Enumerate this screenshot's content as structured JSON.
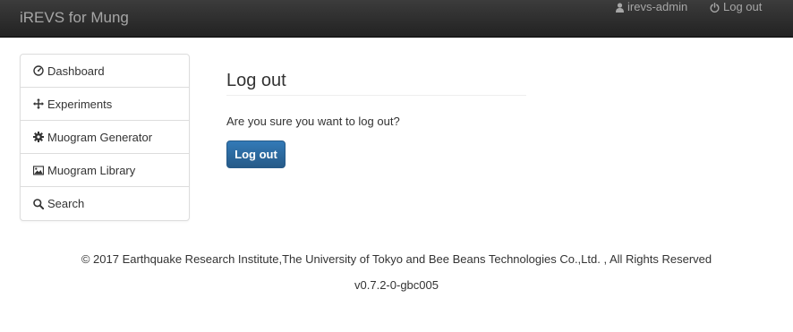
{
  "navbar": {
    "brand": "iREVS for Mung",
    "user_label": "irevs-admin",
    "logout_label": "Log out",
    "user_icon": "user-icon",
    "logout_icon": "power-icon"
  },
  "sidebar": {
    "items": [
      {
        "label": "Dashboard",
        "icon": "dashboard-icon"
      },
      {
        "label": "Experiments",
        "icon": "move-icon"
      },
      {
        "label": "Muogram Generator",
        "icon": "cog-icon"
      },
      {
        "label": "Muogram Library",
        "icon": "picture-icon"
      },
      {
        "label": "Search",
        "icon": "search-icon"
      }
    ]
  },
  "main": {
    "title": "Log out",
    "confirm_text": "Are you sure you want to log out?",
    "button_label": "Log out"
  },
  "footer": {
    "copyright": "© 2017 Earthquake Research Institute,The University of Tokyo and Bee Beans Technologies Co.,Ltd. , All Rights Reserved",
    "version": "v0.7.2-0-gbc005"
  },
  "colors": {
    "navbar_bg": "#222222",
    "navbar_text": "#a6a6a6",
    "button_bg": "#337ab7",
    "border": "#dddddd"
  }
}
